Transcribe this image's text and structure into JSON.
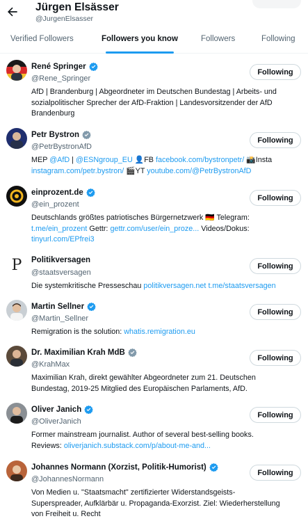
{
  "header": {
    "name": "Jürgen Elsässer",
    "handle": "@JurgenElsasser",
    "back_icon": "arrow-left-icon"
  },
  "tabs": [
    {
      "label": "Verified Followers",
      "active": false
    },
    {
      "label": "Followers you know",
      "active": true
    },
    {
      "label": "Followers",
      "active": false
    },
    {
      "label": "Following",
      "active": false
    }
  ],
  "accent_color": "#1d9bf0",
  "users": [
    {
      "name": "René Springer",
      "handle": "@Rene_Springer",
      "verified": "blue",
      "button": "Following",
      "bio": [
        {
          "t": "AfD | Brandenburg | Abgeordneter im Deutschen Bundestag | Arbeits- und"
        },
        {
          "br": true
        },
        {
          "t": "sozialpolitischer Sprecher der AfD-Fraktion | Landesvorsitzender der AfD"
        },
        {
          "br": true
        },
        {
          "t": "Brandenburg"
        }
      ]
    },
    {
      "name": "Petr Bystron",
      "handle": "@PetrBystronAfD",
      "verified": "gray",
      "button": "Following",
      "bio": [
        {
          "t": "MEP "
        },
        {
          "l": "@AfD"
        },
        {
          "t": " | "
        },
        {
          "l": "@ESNgroup_EU"
        },
        {
          "t": " 👤FB "
        },
        {
          "l": "facebook.com/bystronpetr/"
        },
        {
          "t": " 📸Insta"
        },
        {
          "br": true
        },
        {
          "l": "instagram.com/petr.bystron/"
        },
        {
          "t": " 🎬YT "
        },
        {
          "l": "youtube.com/@PetrBystronAfD"
        }
      ]
    },
    {
      "name": "einprozent.de",
      "handle": "@ein_prozent",
      "verified": "blue",
      "button": "Following",
      "bio": [
        {
          "t": "Deutschlands größtes patriotisches Bürgernetzwerk 🇩🇪 Telegram:"
        },
        {
          "br": true
        },
        {
          "l": "t.me/ein_prozent"
        },
        {
          "t": " Gettr: "
        },
        {
          "l": "gettr.com/user/ein_proze..."
        },
        {
          "t": " Videos/Dokus:"
        },
        {
          "br": true
        },
        {
          "l": "tinyurl.com/EPfrei3"
        }
      ]
    },
    {
      "name": "Politikversagen",
      "handle": "@staatsversagen",
      "verified": "none",
      "button": "Following",
      "bio": [
        {
          "t": "Die systemkritische Presseschau "
        },
        {
          "l": "politikversagen.net"
        },
        {
          "t": " "
        },
        {
          "l": "t.me/staatsversagen"
        }
      ]
    },
    {
      "name": "Martin Sellner",
      "handle": "@Martin_Sellner",
      "verified": "blue",
      "button": "Following",
      "bio": [
        {
          "t": "Remigration is the solution: "
        },
        {
          "l": "whatis.remigration.eu"
        }
      ]
    },
    {
      "name": "Dr. Maximilian Krah MdB",
      "handle": "@KrahMax",
      "verified": "gray",
      "button": "Following",
      "bio": [
        {
          "t": "Maximilian Krah, direkt gewählter Abgeordneter zum 21. Deutschen"
        },
        {
          "br": true
        },
        {
          "t": "Bundestag, 2019-25 Mitglied des Europäischen Parlaments, AfD."
        }
      ]
    },
    {
      "name": "Oliver Janich",
      "handle": "@OliverJanich",
      "verified": "blue",
      "button": "Following",
      "bio": [
        {
          "t": "Former mainstream journalist. Author of several best-selling books."
        },
        {
          "br": true
        },
        {
          "t": "Reviews: "
        },
        {
          "l": "oliverjanich.substack.com/p/about-me-and..."
        }
      ]
    },
    {
      "name": "Johannes Normann (Xorzist, Politik-Humorist)",
      "handle": "@JohannesNormann",
      "verified": "blue",
      "button": "Following",
      "bio": [
        {
          "t": "Von Medien u. \"Staatsmacht\" zertifizierter Widerstandsgeists-"
        },
        {
          "br": true
        },
        {
          "t": "Superspreader, Aufklärbär u. Propaganda-Exorzist. Ziel: Wiederherstellung"
        },
        {
          "br": true
        },
        {
          "t": "von Freiheit u. Recht"
        }
      ]
    }
  ]
}
